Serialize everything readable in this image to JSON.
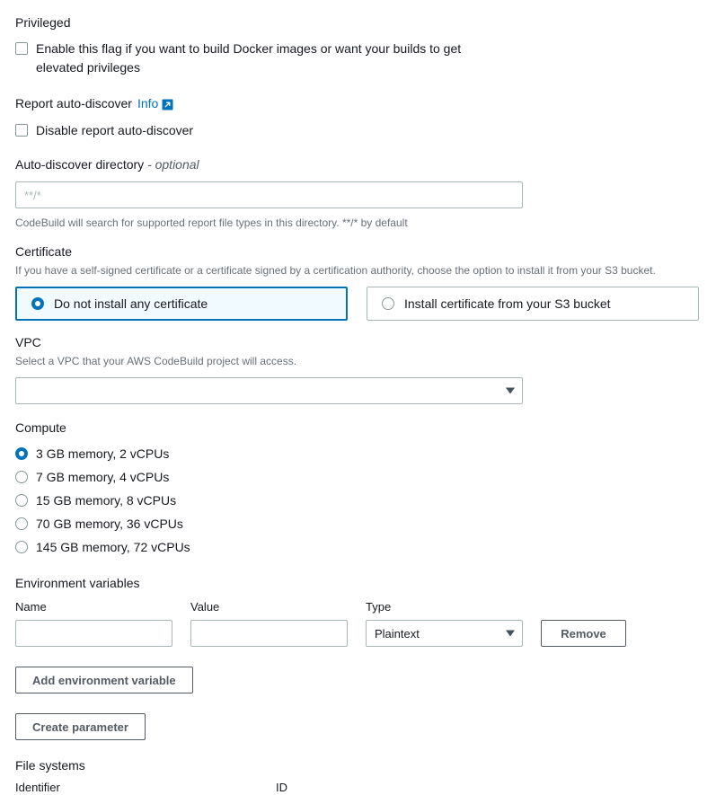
{
  "privileged": {
    "label": "Privileged",
    "checkbox_label": "Enable this flag if you want to build Docker images or want your builds to get elevated privileges",
    "checked": false
  },
  "report_auto_discover": {
    "label": "Report auto-discover",
    "info_label": "Info",
    "info_icon": "external-link-icon",
    "checkbox_label": "Disable report auto-discover",
    "checked": false
  },
  "auto_discover_directory": {
    "label": "Auto-discover directory",
    "optional_suffix": "- optional",
    "placeholder": "**/*",
    "value": "",
    "description": "CodeBuild will search for supported report file types in this directory. **/* by default"
  },
  "certificate": {
    "label": "Certificate",
    "description": "If you have a self-signed certificate or a certificate signed by a certification authority, choose the option to install it from your S3 bucket.",
    "options": [
      {
        "label": "Do not install any certificate",
        "selected": true
      },
      {
        "label": "Install certificate from your S3 bucket",
        "selected": false
      }
    ]
  },
  "vpc": {
    "label": "VPC",
    "description": "Select a VPC that your AWS CodeBuild project will access.",
    "selected_value": "",
    "caret_icon": "chevron-down-icon"
  },
  "compute": {
    "label": "Compute",
    "options": [
      {
        "label": "3 GB memory, 2 vCPUs",
        "selected": true
      },
      {
        "label": "7 GB memory, 4 vCPUs",
        "selected": false
      },
      {
        "label": "15 GB memory, 8 vCPUs",
        "selected": false
      },
      {
        "label": "70 GB memory, 36 vCPUs",
        "selected": false
      },
      {
        "label": "145 GB memory, 72 vCPUs",
        "selected": false
      }
    ]
  },
  "environment_variables": {
    "label": "Environment variables",
    "columns": [
      "Name",
      "Value",
      "Type"
    ],
    "rows": [
      {
        "name": "",
        "value": "",
        "type": "Plaintext",
        "remove_label": "Remove"
      }
    ],
    "add_button": "Add environment variable",
    "create_parameter_button": "Create parameter"
  },
  "file_systems": {
    "label": "File systems",
    "columns": [
      "Identifier",
      "ID"
    ]
  },
  "colors": {
    "accent": "#0073bb",
    "text": "#16191f",
    "muted": "#687078",
    "border": "#aab7b8",
    "button_border": "#545b64",
    "tile_selected_bg": "#f1faff"
  }
}
